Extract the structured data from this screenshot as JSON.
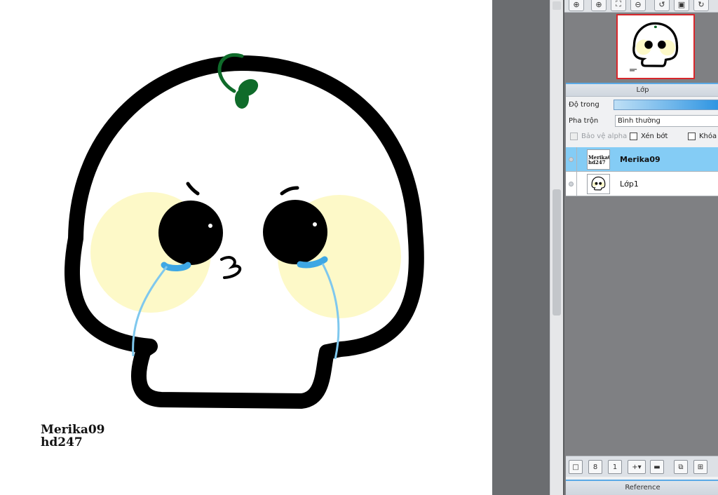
{
  "artwork": {
    "signature_line1": "Merika09",
    "signature_line2": "hd247",
    "colors": {
      "outline": "#000000",
      "blush": "#fdf9c8",
      "tears": "#3ea7e4",
      "tears_light": "#7fc8ee",
      "sprout": "#0f6b2a"
    }
  },
  "navigator": {
    "buttons": [
      "zoom-fit-icon",
      "zoom-in-icon",
      "fit-window-icon",
      "zoom-out-icon",
      "rotate-left-icon",
      "flip-icon",
      "rotate-right-icon"
    ]
  },
  "layer_panel": {
    "title": "Lớp",
    "opacity_label": "Độ trong",
    "blend_label": "Pha trộn",
    "blend_value": "Bình thường",
    "protect_alpha_label": "Bảo vệ alpha",
    "clipping_label": "Xén bớt",
    "lock_label": "Khóa",
    "layers": [
      {
        "name": "Merika09",
        "thumb_line1": "Merika09",
        "thumb_line2": "hd247",
        "selected": true
      },
      {
        "name": "Lớp1",
        "selected": false
      }
    ],
    "bottom_buttons": [
      "new-layer-icon",
      "new-8bit-layer-icon",
      "new-1bit-layer-icon",
      "add-menu-icon",
      "folder-icon",
      "duplicate-layer-icon",
      "merge-layer-icon"
    ]
  },
  "reference_panel": {
    "title": "Reference"
  }
}
